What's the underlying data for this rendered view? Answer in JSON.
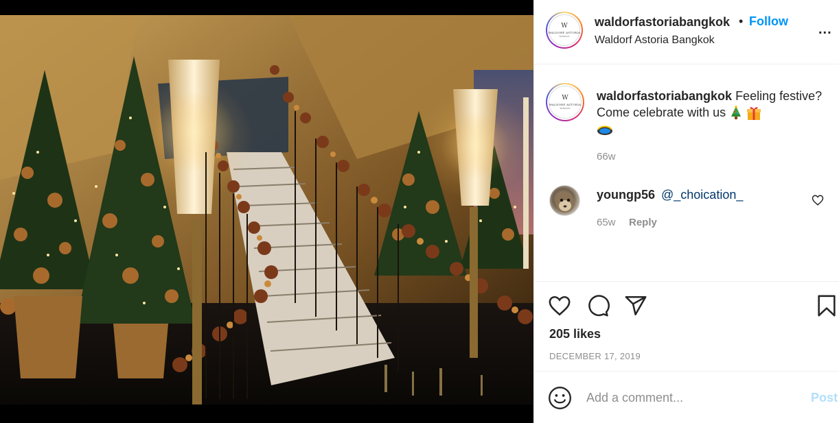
{
  "post": {
    "image_alt": "Christmas trees and illuminated staircase with ornament garland",
    "header": {
      "username": "waldorfastoriabangkok",
      "separator": "•",
      "follow_label": "Follow",
      "location": "Waldorf Astoria Bangkok",
      "more_label": "...",
      "avatar_logo": {
        "mark": "W",
        "name": "WALDORF ASTORIA",
        "city": "BANGKOK"
      }
    },
    "caption": {
      "username": "waldorfastoriabangkok",
      "text": "Feeling festive? Come celebrate with us",
      "emojis": [
        "christmas-tree",
        "wrapped-gift",
        "diving-mask"
      ],
      "time": "66w"
    },
    "comments": [
      {
        "username": "youngp56",
        "text": "@_choication_",
        "time": "65w",
        "reply_label": "Reply"
      }
    ],
    "likes": "205 likes",
    "date": "DECEMBER 17, 2019",
    "add_comment": {
      "placeholder": "Add a comment...",
      "post_label": "Post"
    },
    "icons": [
      "heart-icon",
      "comment-icon",
      "share-icon",
      "bookmark-icon",
      "smiley-icon"
    ]
  },
  "colors": {
    "follow": "#0095f6",
    "mention": "#00376b",
    "meta_gray": "#8e8e8e",
    "post_disabled": "#b2dffc",
    "text": "#262626"
  }
}
